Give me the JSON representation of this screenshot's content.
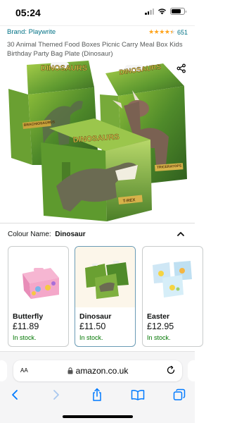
{
  "status_bar": {
    "time": "05:24",
    "battery_level": 0.75
  },
  "product": {
    "brand_link": "Brand: Playwrite",
    "rating_stars": 4.5,
    "rating_count": "651",
    "title": "30 Animal Themed Food Boxes Picnic Carry Meal Box Kids Birthday Party Bag Plate (Dinosaur)",
    "image_labels": [
      "DINOSAURS",
      "DINOSAURS",
      "DINOSAURS",
      "BRACHIOSAURUS",
      "TRICERATOPS",
      "T-REX"
    ]
  },
  "colour": {
    "label": "Colour Name:",
    "selected": "Dinosaur",
    "options": [
      {
        "name": "Butterfly",
        "price": "£11.89",
        "stock": "In stock."
      },
      {
        "name": "Dinosaur",
        "price": "£11.50",
        "stock": "In stock."
      },
      {
        "name": "Easter",
        "price": "£12.95",
        "stock": "In stock."
      }
    ]
  },
  "browser": {
    "aa_label": "AA",
    "url": "amazon.co.uk"
  },
  "icons": {
    "share": "share-icon",
    "chevron": "chevron-up-icon",
    "lock": "lock-icon",
    "reload": "reload-icon",
    "back": "back-arrow-icon",
    "forward": "forward-arrow-icon",
    "share_toolbar": "share-icon",
    "bookmarks": "book-icon",
    "tabs": "tabs-icon"
  },
  "colors": {
    "link": "#007185",
    "star": "#FFA41C",
    "stock": "#007600",
    "ios_blue": "#007AFF"
  }
}
